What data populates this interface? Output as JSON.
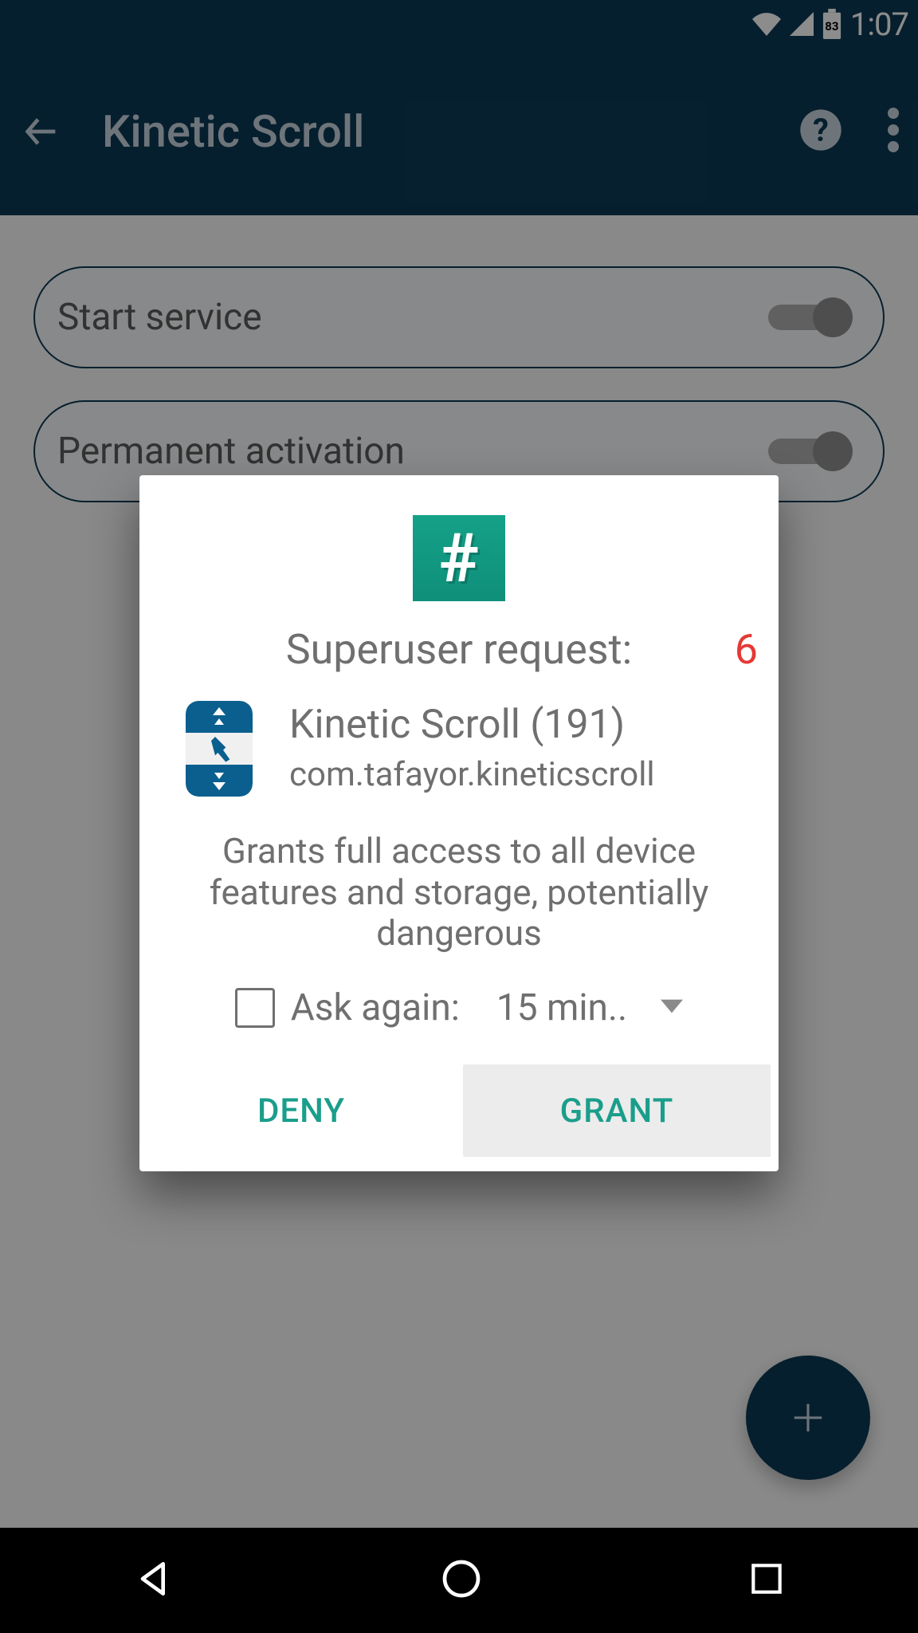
{
  "status_bar": {
    "battery_level": "83",
    "time": "1:07"
  },
  "header": {
    "title": "Kinetic Scroll"
  },
  "pills": {
    "start_service": "Start service",
    "permanent_activation": "Permanent activation"
  },
  "dialog": {
    "title": "Superuser request:",
    "counter": "6",
    "app_name": "Kinetic Scroll (191)",
    "app_package": "com.tafayor.kineticscroll",
    "warning": "Grants full access to all device features and storage, potentially dangerous",
    "ask_again_label": "Ask again:",
    "duration": "15 min..",
    "deny_label": "DENY",
    "grant_label": "GRANT"
  }
}
